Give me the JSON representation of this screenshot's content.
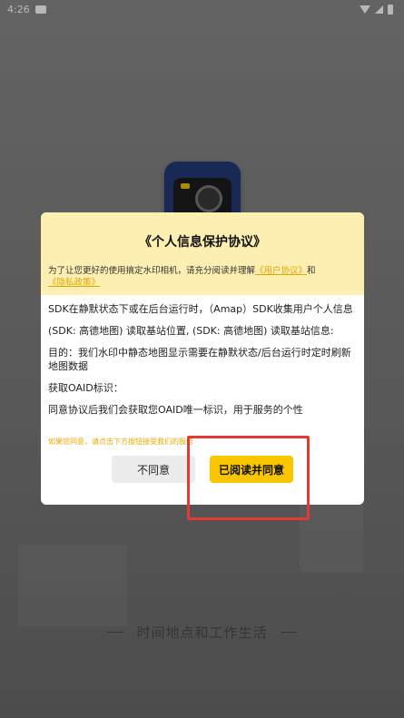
{
  "status_bar": {
    "time": "4:26"
  },
  "background": {
    "slogan": "时间地点和工作生活"
  },
  "dialog": {
    "title": "《个人信息保护协议》",
    "intro_prefix": "为了让您更好的使用搞定水印相机，请充分阅读并理解",
    "user_agreement_link": "《用户协议》",
    "and_text": "和",
    "privacy_link": "《隐私政策》",
    "paragraphs": [
      "SDK在静默状态下或在后台运行时，（Amap）SDK收集用户个人信息",
      "(SDK: 高德地图) 读取基站位置, (SDK: 高德地图) 读取基站信息:",
      "目的：我们水印中静态地图显示需要在静默状态/后台运行时定时刷新地图数据",
      "获取OAID标识：",
      "同意协议后我们会获取您OAID唯一标识，用于服务的个性"
    ],
    "hint": "如果您同意，请点击下方按钮接受我们的服务",
    "disagree_label": "不同意",
    "agree_label": "已阅读并同意"
  },
  "colors": {
    "header_bg": "#fdefb2",
    "accent": "#f9c600",
    "link": "#e0a800",
    "highlight": "#e53935"
  }
}
